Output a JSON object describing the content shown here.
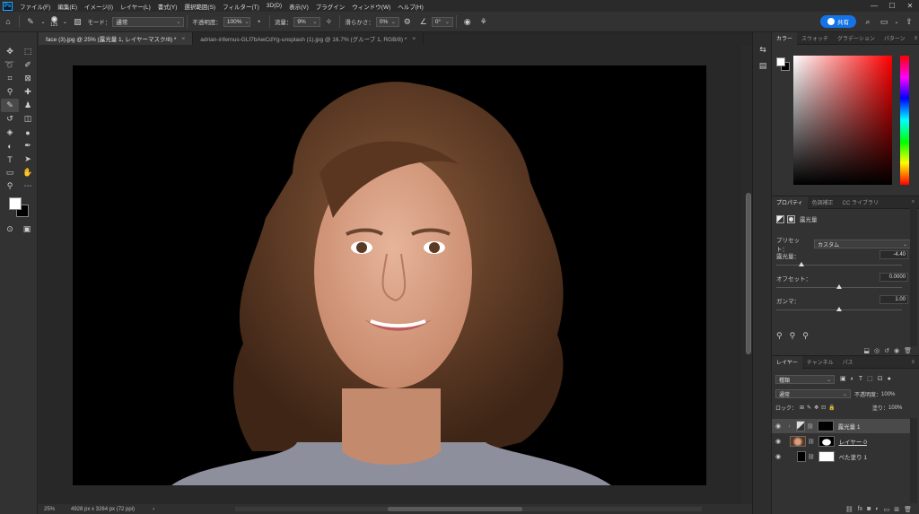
{
  "app": {
    "logo": "Ps"
  },
  "menu": [
    "ファイル(F)",
    "編集(E)",
    "イメージ(I)",
    "レイヤー(L)",
    "書式(Y)",
    "選択範囲(S)",
    "フィルター(T)",
    "3D(D)",
    "表示(V)",
    "プラグイン",
    "ウィンドウ(W)",
    "ヘルプ(H)"
  ],
  "window_controls": [
    "—",
    "☐",
    "✕"
  ],
  "options": {
    "brush_size": "125",
    "mode_label": "モード：",
    "mode_value": "通常",
    "opacity_label": "不透明度：",
    "opacity_value": "100%",
    "flow_label": "流量：",
    "flow_value": "9%",
    "smoothing_label": "滑らかさ：",
    "smoothing_value": "0%",
    "angle_value": "0°",
    "share_label": "共有"
  },
  "tabs": [
    {
      "label": "face (3).jpg @ 25% (露光量 1, レイヤーマスク/8) *",
      "close": "×"
    },
    {
      "label": "adrian-infernus-GLf7bAwCdYg-unsplash (1).jpg @ 16.7% (グループ 1, RGB/8) *",
      "close": "×"
    }
  ],
  "status": {
    "zoom": "25%",
    "dims": "4928 px x 3264 px (72 ppi)",
    "arrow": "›"
  },
  "color_panel": {
    "tabs": [
      "カラー",
      "スウォッチ",
      "グラデーション",
      "パターン"
    ]
  },
  "properties": {
    "tabs": [
      "プロパティ",
      "色調補正",
      "CC ライブラリ"
    ],
    "title": "露光量",
    "preset_label": "プリセット：",
    "preset_value": "カスタム",
    "exposure_label": "露光量：",
    "exposure_value": "-4.40",
    "exposure_level": 0.2,
    "offset_label": "オフセット：",
    "offset_value": "0.0000",
    "offset_level": 0.5,
    "gamma_label": "ガンマ：",
    "gamma_value": "1.00",
    "gamma_level": 0.5
  },
  "layers": {
    "tabs": [
      "レイヤー",
      "チャンネル",
      "パス"
    ],
    "filter_value": "種類",
    "blend_value": "通常",
    "opacity_label": "不透明度：",
    "opacity_value": "100%",
    "lock_label": "ロック：",
    "fill_label": "塗り：",
    "fill_value": "100%",
    "items": [
      {
        "name": "露光量 1",
        "selected": true
      },
      {
        "name": "レイヤー 0",
        "selected": false
      },
      {
        "name": "べた塗り 1",
        "selected": false
      }
    ]
  }
}
